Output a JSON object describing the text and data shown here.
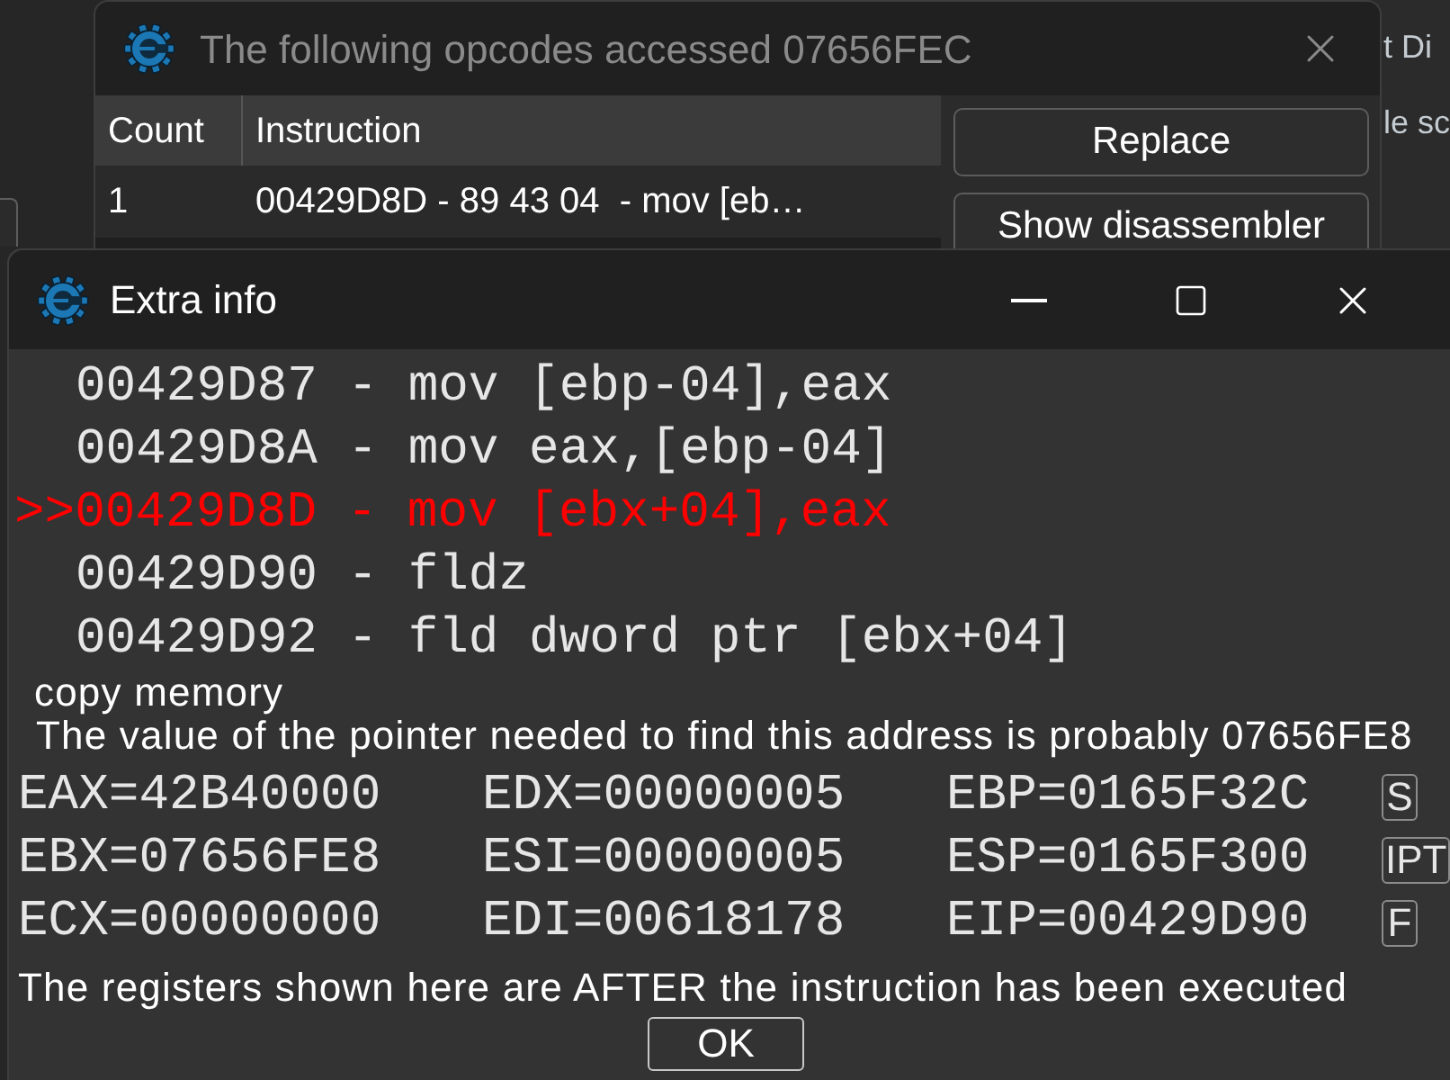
{
  "background": {
    "texts": [
      "t Di",
      "le sc"
    ]
  },
  "opcodes_window": {
    "title": "The following opcodes accessed 07656FEC",
    "active": false,
    "table": {
      "columns": [
        "Count",
        "Instruction"
      ],
      "rows": [
        [
          "1",
          "00429D8D - 89 43 04  - mov [eb…"
        ]
      ]
    },
    "buttons": [
      "Replace",
      "Show disassembler"
    ]
  },
  "extra_info_window": {
    "title": "Extra info",
    "active": true,
    "disassembly": [
      {
        "text": "00429D87 - mov [ebp-04],eax",
        "current": false
      },
      {
        "text": "00429D8A - mov eax,[ebp-04]",
        "current": false
      },
      {
        "marker": ">>",
        "text": "00429D8D - mov [ebx+04],eax",
        "current": true
      },
      {
        "text": "00429D90 - fldz",
        "current": false
      },
      {
        "text": "00429D92 - fld dword ptr [ebx+04]",
        "current": false
      }
    ],
    "copy_memory": "copy memory",
    "pointer_note": "The value of the pointer needed to find this address is probably 07656FE8",
    "registers": [
      [
        "EAX=42B40000",
        "EDX=00000005",
        "EBP=0165F32C"
      ],
      [
        "EBX=07656FE8",
        "ESI=00000005",
        "ESP=0165F300"
      ],
      [
        "ECX=00000000",
        "EDI=00618178",
        "EIP=00429D90"
      ]
    ],
    "flag_buttons": [
      "S",
      "IPT",
      "F"
    ],
    "note": "The registers shown here are AFTER the instruction has been executed",
    "ok_button": "OK"
  }
}
